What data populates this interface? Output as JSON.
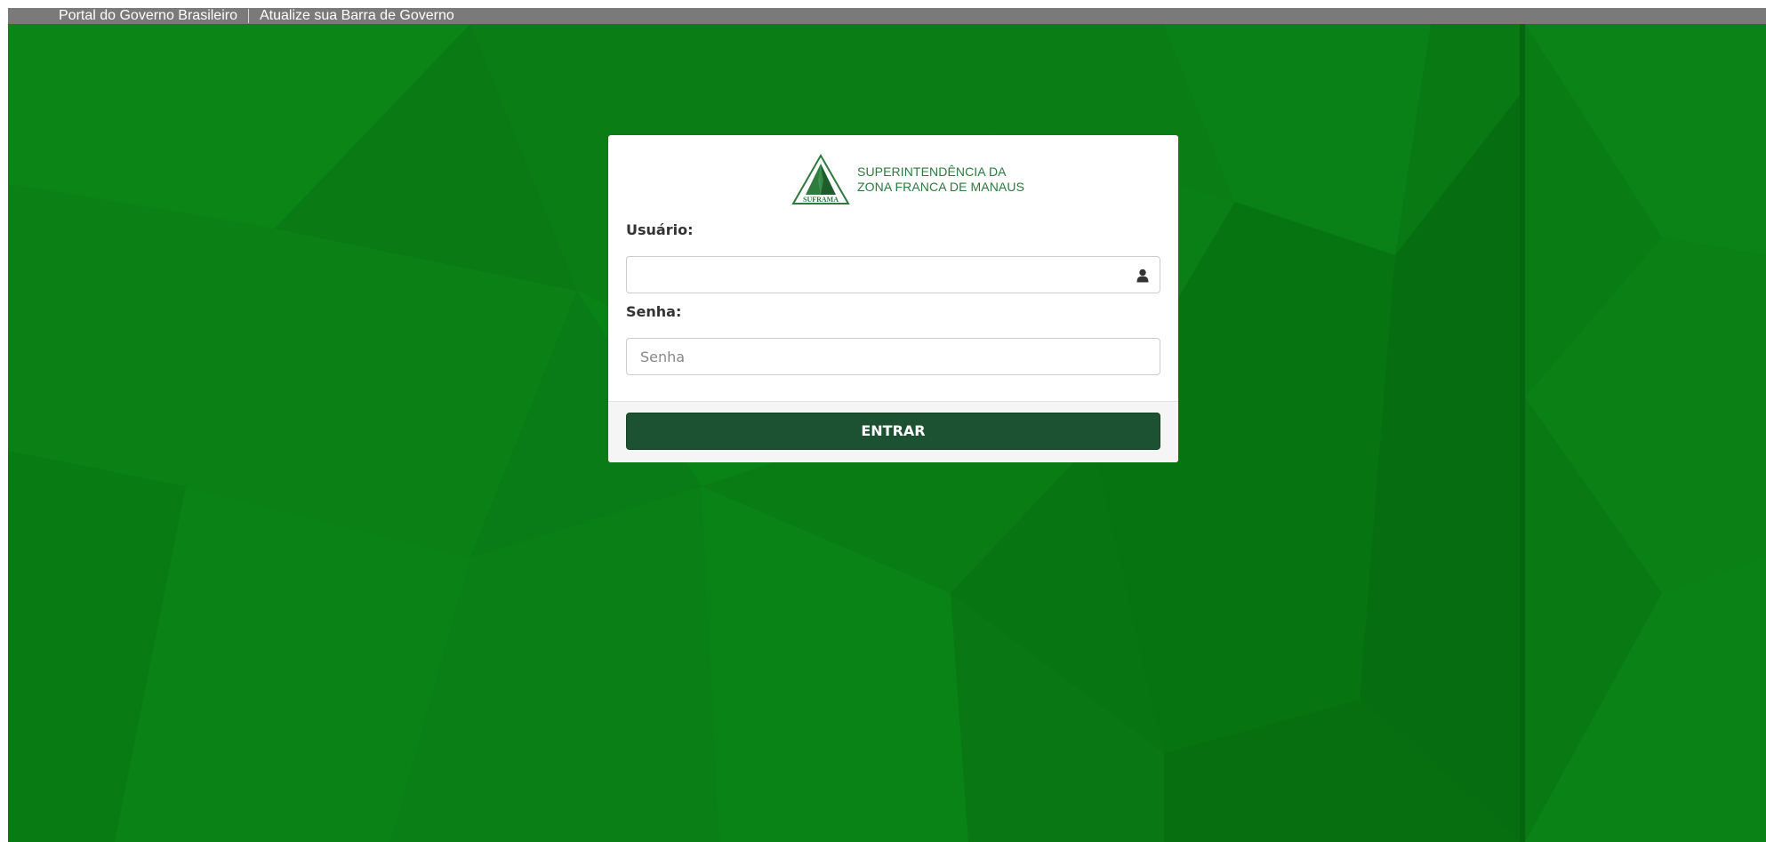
{
  "gov_bar": {
    "portal_link": "Portal do Governo Brasileiro",
    "update_link": "Atualize sua Barra de Governo"
  },
  "logo": {
    "emblem_text": "SUFRAMA",
    "line1": "SUPERINTENDÊNCIA DA",
    "line2": "ZONA FRANCA DE MANAUS"
  },
  "form": {
    "username_label": "Usuário:",
    "username_value": "",
    "username_icon": "user-icon",
    "password_label": "Senha:",
    "password_placeholder": "Senha",
    "submit_label": "ENTRAR"
  },
  "colors": {
    "background_green": "#0a7e14",
    "gov_bar": "#7a7a7a",
    "button": "#1c5131",
    "logo_green": "#2c7a3d"
  }
}
